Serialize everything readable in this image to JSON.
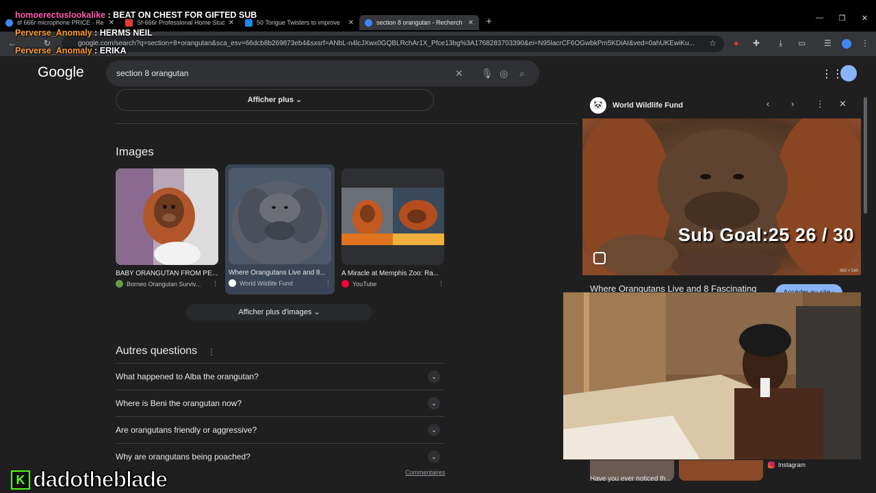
{
  "chat": [
    {
      "user": "homoerectuslookalike",
      "sep": " : ",
      "msg": "BEAT ON CHEST FOR GIFTED SUB"
    },
    {
      "user": "Perverse_Anomaly",
      "sep": " : ",
      "msg": "HERMS NEIL"
    },
    {
      "user": "Perverse_Anomaly",
      "sep": " : ",
      "msg": "ERIKA"
    }
  ],
  "browser": {
    "tabs": [
      {
        "title": "sf 666r microphone PRICE - Re"
      },
      {
        "title": "Sf-666r Professional Home Stud"
      },
      {
        "title": "50 Tongue Twisters to improve"
      },
      {
        "title": "section 8 orangutan - Recherch"
      }
    ],
    "new_tab": "+",
    "url": "google.com/search?q=section+8+orangutan&sca_esv=66dcb8b269873eb4&sxsrf=ANbL-n4lcJXwx0GQBLRchAr1X_Pfce13bg%3A1768283703390&ei=N95lacrCF6OGwbkPm5KDiAI&ved=0ahUKEwiKu..."
  },
  "google": {
    "logo": "Google",
    "query": "section 8 orangutan",
    "show_more": "Afficher plus",
    "images_title": "Images",
    "images": [
      {
        "caption": "BABY ORANGUTAN FROM PE...",
        "source": "Borneo Orangutan Surviv..."
      },
      {
        "caption": "Where Orangutans Live and 8...",
        "source": "World Wildlife Fund"
      },
      {
        "caption": "A Miracle at Memphis Zoo: Ra...",
        "source": "YouTube"
      }
    ],
    "show_images": "Afficher plus d'images",
    "paa_title": "Autres questions",
    "questions": [
      "What happened to Alba the orangutan?",
      "Where is Beni the orangutan now?",
      "Are orangutans friendly or aggressive?",
      "Why are orangutans being poached?"
    ],
    "feedback": "Commentaires"
  },
  "preview": {
    "source": "World Wildlife Fund",
    "dims": "960 × 540",
    "title": "Where Orangutans Live and 8 Fascinating",
    "visit": "Accéder au site",
    "bottom_title": "Have you ever noticed th...",
    "instagram": "Instagram"
  },
  "overlay": {
    "sub_goal": "Sub Goal:25   26 / 30",
    "streamer": "dadotheblade",
    "kick_logo": "K"
  }
}
